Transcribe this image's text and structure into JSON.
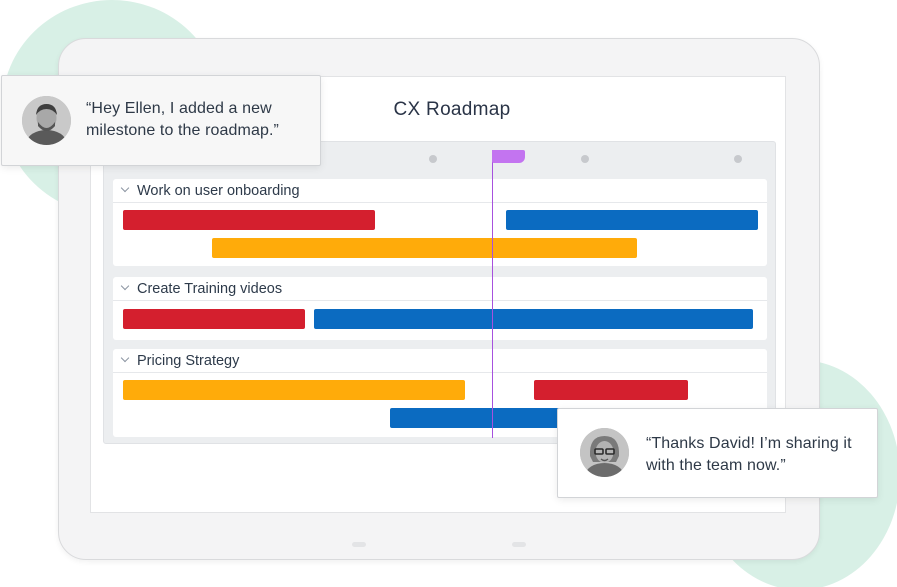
{
  "page": {
    "title": "CX Roadmap"
  },
  "colors": {
    "red": "#d41f2e",
    "blue": "#0b6bc1",
    "amber": "#ffab0a",
    "milestone": "#c374f0",
    "background_blob": "#d8f0e6"
  },
  "groups": [
    {
      "label": "Work on user onboarding",
      "icon": "chevron-down-icon"
    },
    {
      "label": "Create Training videos",
      "icon": "chevron-down-icon"
    },
    {
      "label": "Pricing Strategy",
      "icon": "chevron-down-icon"
    }
  ],
  "messages": {
    "david": {
      "text": "“Hey Ellen, I added a new milestone to the roadmap.”",
      "avatar_icon": "avatar-david-icon"
    },
    "ellen": {
      "text": "“Thanks David! I’m sharing it with the team now.”",
      "avatar_icon": "avatar-ellen-icon"
    }
  }
}
